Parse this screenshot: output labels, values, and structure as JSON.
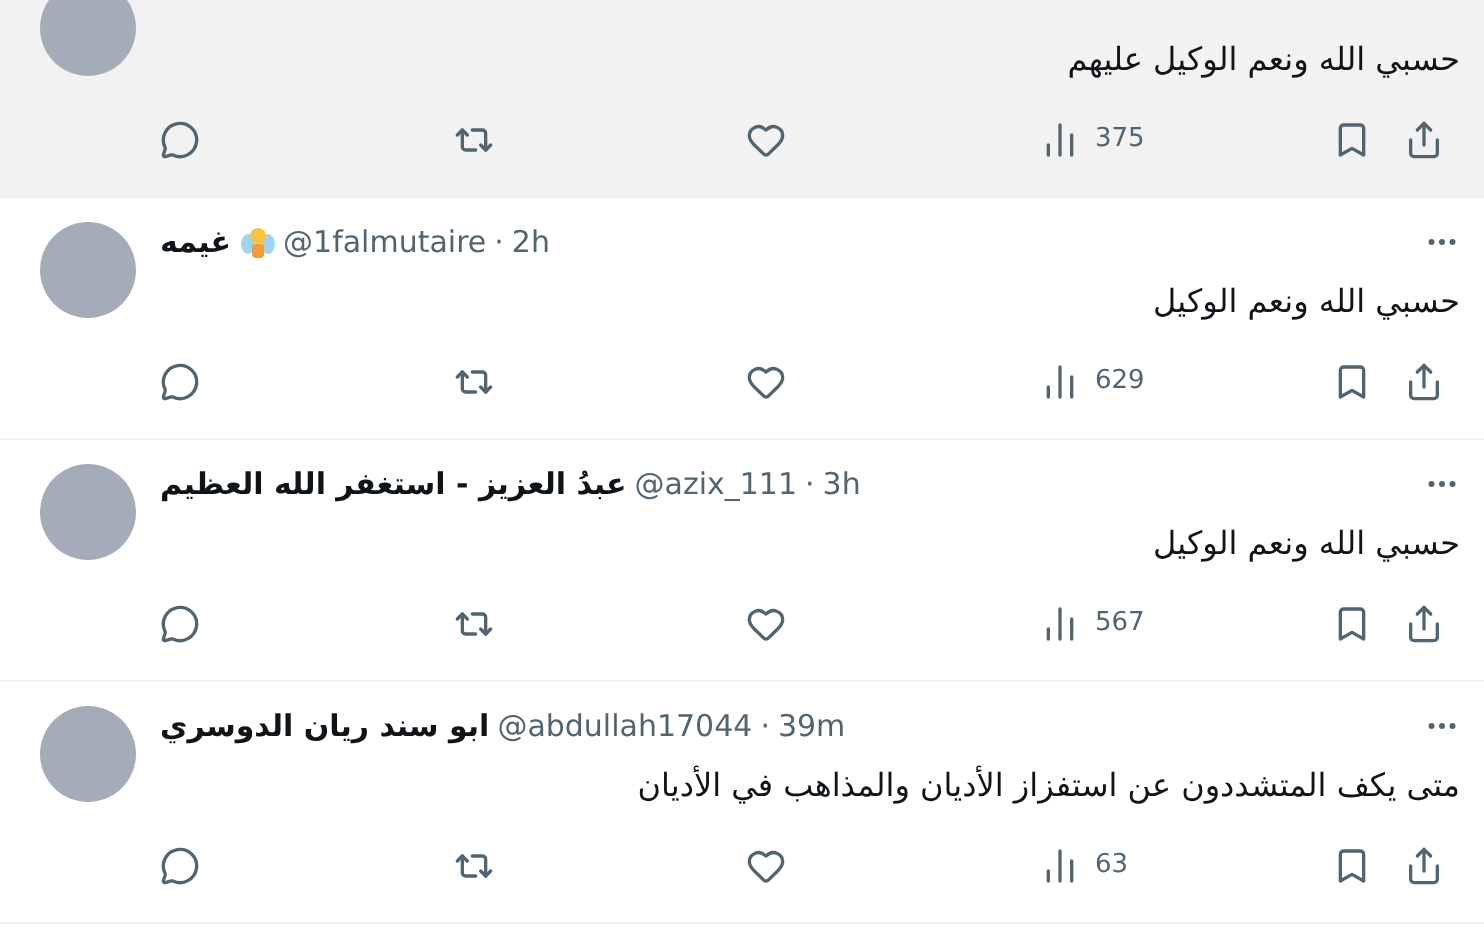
{
  "tweets": [
    {
      "highlighted": true,
      "text": "حسبي الله ونعم الوكيل عليهم",
      "views": "375"
    },
    {
      "highlighted": false,
      "kind": "emoji",
      "name": "غيمه",
      "handle": "@1falmutaire",
      "dot": "·",
      "time": "2h",
      "text": "حسبي الله ونعم الوكيل",
      "views": "629"
    },
    {
      "highlighted": false,
      "kind": "plain",
      "name": "عبدُ العزيز - استغفر الله العظيم",
      "handle": "@azix_111",
      "dot": "·",
      "time": "3h",
      "text": "حسبي الله ونعم الوكيل",
      "views": "567"
    },
    {
      "highlighted": false,
      "kind": "plain",
      "name": "ابو سند ريان الدوسري",
      "handle": "@abdullah17044",
      "dot": "·",
      "time": "39m",
      "text": "متى يكف المتشددون عن استفزاز الأديان والمذاهب في الأديان",
      "views": "63"
    }
  ]
}
